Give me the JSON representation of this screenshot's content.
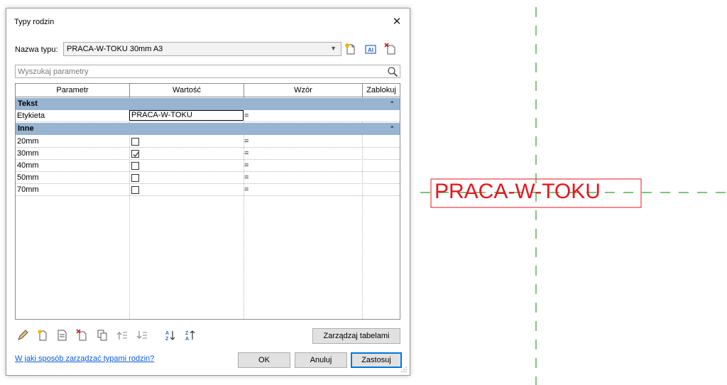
{
  "canvas": {
    "tag_text": "PRACA-W-TOKU",
    "tag_color": "#e8141c",
    "gridline_color": "#2ea02e"
  },
  "dialog": {
    "title": "Typy rodzin",
    "close_glyph": "✕",
    "type_label": "Nazwa typu:",
    "type_value": "PRACA-W-TOKU 30mm A3",
    "search_placeholder": "Wyszukaj parametry",
    "columns": [
      "Parametr",
      "Wartość",
      "Wzór",
      "Zablokuj"
    ],
    "groups": [
      {
        "label": "Tekst",
        "chevron": "⌃"
      },
      {
        "label": "Inne",
        "chevron": "⌃"
      }
    ],
    "text_param": {
      "name": "Etykieta",
      "value": "PRACA-W-TOKU",
      "formula": "="
    },
    "other_params": [
      {
        "name": "20mm",
        "checked": false,
        "formula": "="
      },
      {
        "name": "30mm",
        "checked": true,
        "formula": "="
      },
      {
        "name": "40mm",
        "checked": false,
        "formula": "="
      },
      {
        "name": "50mm",
        "checked": false,
        "formula": "="
      },
      {
        "name": "70mm",
        "checked": false,
        "formula": "="
      }
    ],
    "manage_tables_label": "Zarządzaj tabelami",
    "help_link": "W jaki sposób zarządzać typami rodzin?",
    "ok_label": "OK",
    "cancel_label": "Anuluj",
    "apply_label": "Zastosuj",
    "selection_color": "#99b4d1",
    "link_color": "#0b5bd8"
  }
}
